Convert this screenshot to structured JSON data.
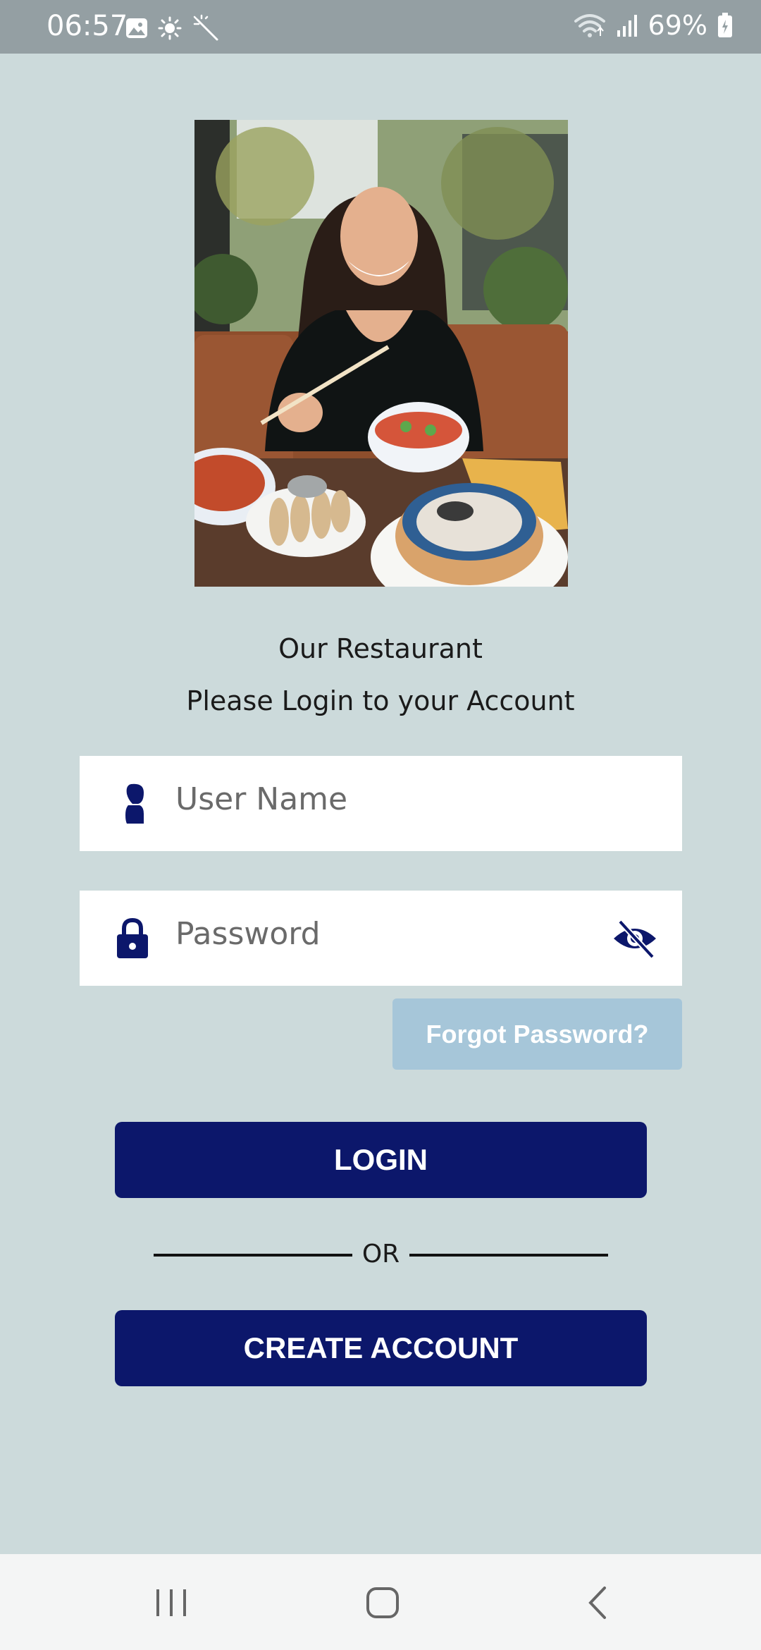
{
  "status_bar": {
    "time": "06:57",
    "battery": "69%",
    "icons": [
      "gallery-icon",
      "brightness-icon",
      "magic-wand-icon",
      "wifi-icon",
      "signal-icon",
      "battery-icon"
    ]
  },
  "hero": {
    "alt": "Smiling woman eating dumplings at a restaurant table"
  },
  "header": {
    "title": "Our Restaurant",
    "subtitle": "Please Login to your Account"
  },
  "form": {
    "username_placeholder": "User Name",
    "password_placeholder": "Password",
    "forgot_label": "Forgot Password?"
  },
  "actions": {
    "login_label": "LOGIN",
    "or_label": "OR",
    "create_label": "CREATE ACCOUNT"
  },
  "colors": {
    "background": "#ccdadb",
    "primary": "#0c176b",
    "forgot_bg": "#a6c6d9"
  }
}
